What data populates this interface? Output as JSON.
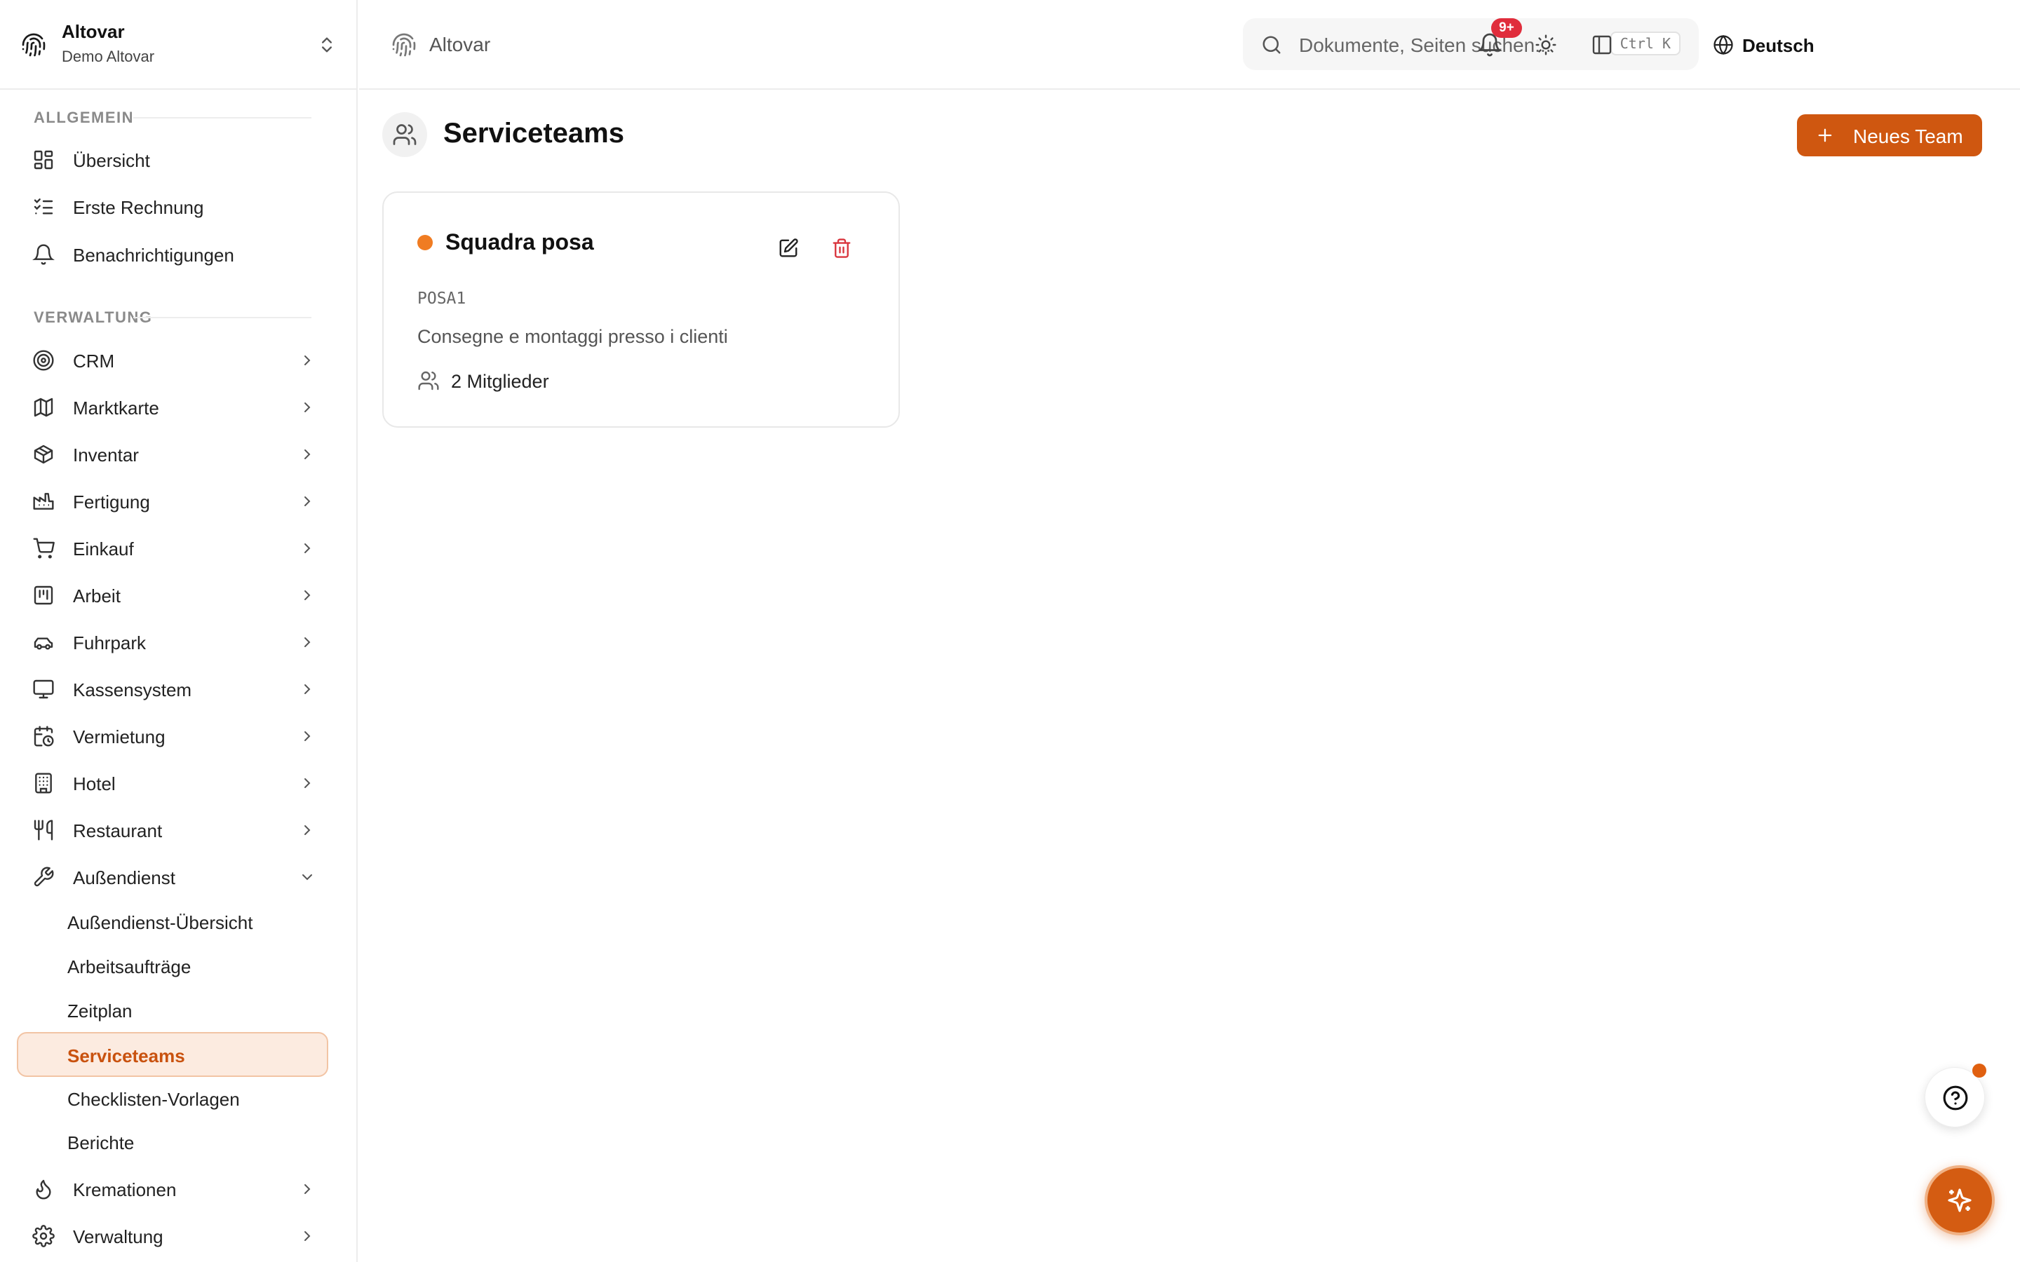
{
  "org": {
    "name": "Altovar",
    "subtitle": "Demo Altovar"
  },
  "sidebar": {
    "section_general": "ALLGEMEIN",
    "general_items": [
      {
        "label": "Übersicht",
        "icon": "dashboard-icon"
      },
      {
        "label": "Erste Rechnung",
        "icon": "checklist-icon"
      },
      {
        "label": "Benachrichtigungen",
        "icon": "bell-icon"
      }
    ],
    "section_admin": "VERWALTUNG",
    "admin_items": [
      {
        "label": "CRM",
        "icon": "target-icon"
      },
      {
        "label": "Marktkarte",
        "icon": "map-icon"
      },
      {
        "label": "Inventar",
        "icon": "package-icon"
      },
      {
        "label": "Fertigung",
        "icon": "factory-icon"
      },
      {
        "label": "Einkauf",
        "icon": "cart-icon"
      },
      {
        "label": "Arbeit",
        "icon": "kanban-icon"
      },
      {
        "label": "Fuhrpark",
        "icon": "car-icon"
      },
      {
        "label": "Kassensystem",
        "icon": "monitor-icon"
      },
      {
        "label": "Vermietung",
        "icon": "calendar-clock-icon"
      },
      {
        "label": "Hotel",
        "icon": "building-icon"
      },
      {
        "label": "Restaurant",
        "icon": "utensils-icon"
      },
      {
        "label": "Außendienst",
        "icon": "wrench-icon"
      }
    ],
    "field_service_sub": [
      {
        "label": "Außendienst-Übersicht"
      },
      {
        "label": "Arbeitsaufträge"
      },
      {
        "label": "Zeitplan"
      },
      {
        "label": "Serviceteams",
        "active": true
      },
      {
        "label": "Checklisten-Vorlagen"
      },
      {
        "label": "Berichte"
      }
    ],
    "bottom_items": [
      {
        "label": "Kremationen",
        "icon": "flame-icon"
      },
      {
        "label": "Verwaltung",
        "icon": "gear-icon"
      }
    ]
  },
  "topbar": {
    "breadcrumb": "Altovar",
    "search_placeholder": "Dokumente, Seiten suchen...",
    "search_shortcut": "Ctrl K",
    "language": "Deutsch",
    "notification_count": "9+"
  },
  "main": {
    "title": "Serviceteams",
    "new_button": "Neues Team",
    "teams": [
      {
        "name": "Squadra posa",
        "code": "POSA1",
        "description": "Consegne e montaggi presso i clienti",
        "members": "2 Mitglieder",
        "color": "#f07c22"
      }
    ]
  },
  "colors": {
    "accent": "#cf5710",
    "active_bg": "#fcebe0",
    "danger": "#d9363e",
    "badge": "#e02d3c"
  }
}
